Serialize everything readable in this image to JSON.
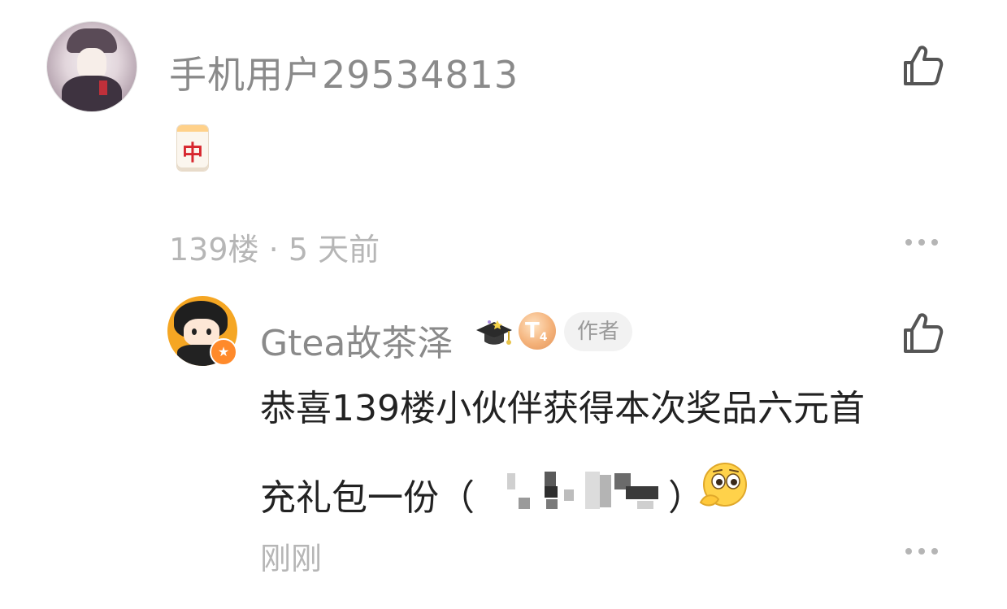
{
  "comment": {
    "username": "手机用户29534813",
    "emoji": "中",
    "floor": "139楼",
    "separator": "·",
    "time": "5 天前",
    "icons": {
      "like": "thumbs-up-outline-icon",
      "more": "more-horizontal-icon"
    }
  },
  "reply": {
    "username": "Gtea故茶泽",
    "level_badge": "T",
    "level_num": "4",
    "author_tag": "作者",
    "text_line1": "恭喜139楼小伙伴获得本次奖品六元首",
    "text_line2_prefix": "充礼包一份（",
    "text_line2_suffix": "）",
    "time": "刚刚",
    "icons": {
      "badge": "graduation-cap-icon",
      "verified": "star-badge-icon",
      "emoji": "thinking-face-emoji",
      "like": "thumbs-up-outline-icon",
      "more": "more-horizontal-icon"
    }
  },
  "colors": {
    "username": "#8a8a8a",
    "meta": "#b6b6b6",
    "text": "#222222",
    "author_tag_bg": "#f2f2f2",
    "level_badge": "#f4b27a"
  }
}
